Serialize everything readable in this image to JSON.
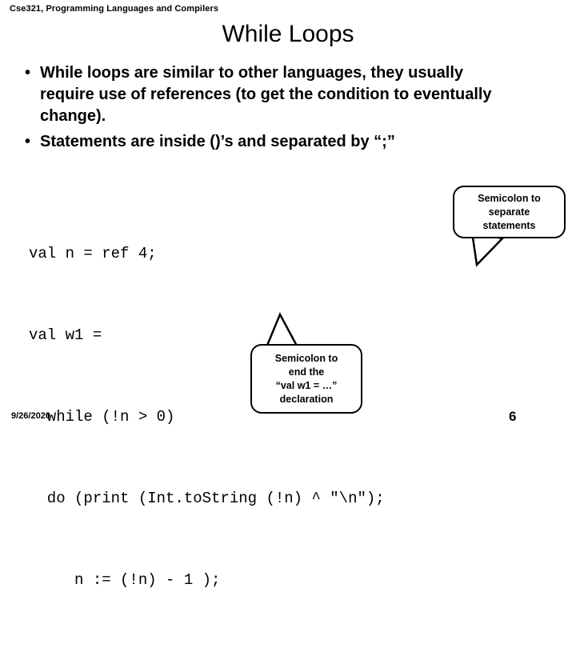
{
  "slide": {
    "header": "Cse321, Programming Languages and Compilers",
    "title": "While Loops",
    "bullet_glyph": "•",
    "bullets": [
      "While loops are similar to other languages, they usually require use of references (to get the condition to eventually change).",
      "Statements are inside ()’s and separated by “;”"
    ],
    "code": {
      "lines": [
        "val n = ref 4;",
        "val w1 =",
        "  while (!n > 0)",
        "  do (print (Int.toString (!n) ^ \"\\n\");",
        "     n := (!n) - 1 );"
      ]
    },
    "callouts": [
      {
        "name": "semicolon-separate",
        "lines": [
          "Semicolon to",
          "separate",
          "statements"
        ]
      },
      {
        "name": "semicolon-end-declaration",
        "lines": [
          "Semicolon to",
          "end the",
          "“val w1 = …”",
          "declaration"
        ]
      }
    ],
    "footer": {
      "date": "9/26/2020",
      "page_number": "6"
    },
    "colors": {
      "background": "#ffffff",
      "text": "#000000",
      "outline": "#000000"
    }
  }
}
